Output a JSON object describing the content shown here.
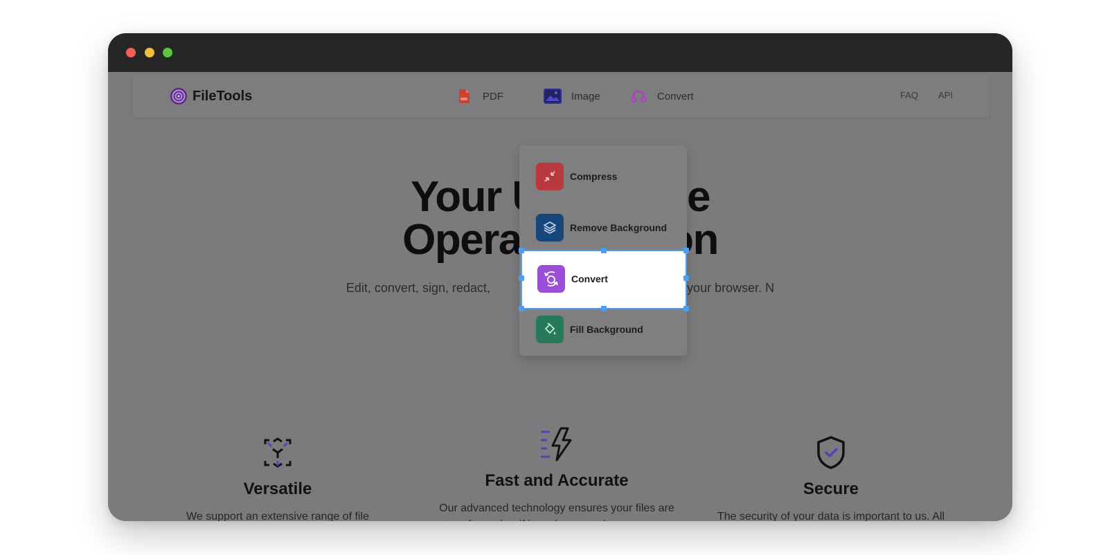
{
  "window": {
    "traffic_lights": [
      "close",
      "minimize",
      "maximize"
    ]
  },
  "navbar": {
    "brand": "FileTools",
    "items": [
      {
        "label": "PDF",
        "icon": "pdf-file-icon"
      },
      {
        "label": "Image",
        "icon": "image-icon"
      },
      {
        "label": "Convert",
        "icon": "convert-headset-icon"
      }
    ],
    "links": [
      "FAQ",
      "API"
    ]
  },
  "dropdown": {
    "items": [
      {
        "label": "Compress",
        "icon": "compress-arrows-icon",
        "color": "#b83a3f"
      },
      {
        "label": "Remove Background",
        "icon": "layers-icon",
        "color": "#17467a"
      },
      {
        "label": "Convert",
        "icon": "convert-cycle-icon",
        "color": "#9b4fd8",
        "selected": true
      },
      {
        "label": "Fill Background",
        "icon": "paint-bucket-icon",
        "color": "#267a5a"
      }
    ]
  },
  "hero": {
    "title_line1": "Your U         File",
    "title_line2": "Operati         tion",
    "subtitle": "Edit, convert, sign, redact,                                          all within your browser. N"
  },
  "features": [
    {
      "title": "Versatile",
      "icon": "versatile-cube-icon",
      "desc": "We support an extensive range of file formats. From PDFs and Images to"
    },
    {
      "title": "Fast and Accurate",
      "icon": "lightning-icon",
      "desc": "Our advanced technology ensures your files are transformed swiftly and accurately, so you can get back to"
    },
    {
      "title": "Secure",
      "icon": "shield-check-icon",
      "desc": "The security of your data is important to us. All files are automatically deleted after"
    }
  ],
  "colors": {
    "accent": "#6b4bd8",
    "selection": "#4a9ef5",
    "pdf": "#d64535",
    "image": "#2f2fa8",
    "convert": "#c23fd0"
  }
}
